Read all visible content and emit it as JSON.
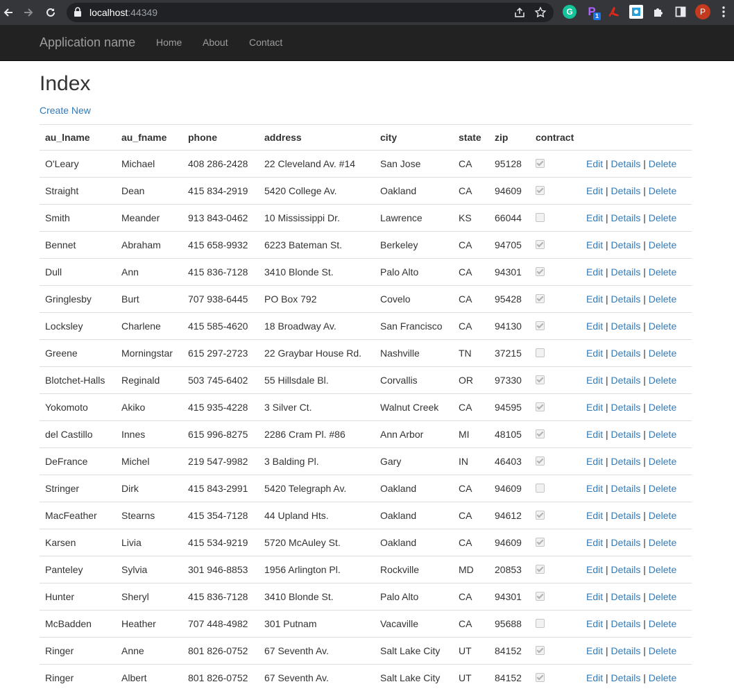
{
  "browser": {
    "url_host": "localhost",
    "url_port": ":44349",
    "profile_initial": "P",
    "ext_grammarly": "G",
    "ext_p": "P",
    "ext_p_badge": "1"
  },
  "navbar": {
    "brand": "Application name",
    "links": [
      "Home",
      "About",
      "Contact"
    ]
  },
  "page": {
    "title": "Index",
    "create_new": "Create New"
  },
  "table": {
    "headers": [
      "au_lname",
      "au_fname",
      "phone",
      "address",
      "city",
      "state",
      "zip",
      "contract"
    ],
    "actions": {
      "edit": "Edit",
      "details": "Details",
      "delete": "Delete",
      "separator": "|"
    },
    "rows": [
      {
        "au_lname": "O'Leary",
        "au_fname": "Michael",
        "phone": "408 286-2428",
        "address": "22 Cleveland Av. #14",
        "city": "San Jose",
        "state": "CA",
        "zip": "95128",
        "contract": true
      },
      {
        "au_lname": "Straight",
        "au_fname": "Dean",
        "phone": "415 834-2919",
        "address": "5420 College Av.",
        "city": "Oakland",
        "state": "CA",
        "zip": "94609",
        "contract": true
      },
      {
        "au_lname": "Smith",
        "au_fname": "Meander",
        "phone": "913 843-0462",
        "address": "10 Mississippi Dr.",
        "city": "Lawrence",
        "state": "KS",
        "zip": "66044",
        "contract": false
      },
      {
        "au_lname": "Bennet",
        "au_fname": "Abraham",
        "phone": "415 658-9932",
        "address": "6223 Bateman St.",
        "city": "Berkeley",
        "state": "CA",
        "zip": "94705",
        "contract": true
      },
      {
        "au_lname": "Dull",
        "au_fname": "Ann",
        "phone": "415 836-7128",
        "address": "3410 Blonde St.",
        "city": "Palo Alto",
        "state": "CA",
        "zip": "94301",
        "contract": true
      },
      {
        "au_lname": "Gringlesby",
        "au_fname": "Burt",
        "phone": "707 938-6445",
        "address": "PO Box 792",
        "city": "Covelo",
        "state": "CA",
        "zip": "95428",
        "contract": true
      },
      {
        "au_lname": "Locksley",
        "au_fname": "Charlene",
        "phone": "415 585-4620",
        "address": "18 Broadway Av.",
        "city": "San Francisco",
        "state": "CA",
        "zip": "94130",
        "contract": true
      },
      {
        "au_lname": "Greene",
        "au_fname": "Morningstar",
        "phone": "615 297-2723",
        "address": "22 Graybar House Rd.",
        "city": "Nashville",
        "state": "TN",
        "zip": "37215",
        "contract": false
      },
      {
        "au_lname": "Blotchet-Halls",
        "au_fname": "Reginald",
        "phone": "503 745-6402",
        "address": "55 Hillsdale Bl.",
        "city": "Corvallis",
        "state": "OR",
        "zip": "97330",
        "contract": true
      },
      {
        "au_lname": "Yokomoto",
        "au_fname": "Akiko",
        "phone": "415 935-4228",
        "address": "3 Silver Ct.",
        "city": "Walnut Creek",
        "state": "CA",
        "zip": "94595",
        "contract": true
      },
      {
        "au_lname": "del Castillo",
        "au_fname": "Innes",
        "phone": "615 996-8275",
        "address": "2286 Cram Pl. #86",
        "city": "Ann Arbor",
        "state": "MI",
        "zip": "48105",
        "contract": true
      },
      {
        "au_lname": "DeFrance",
        "au_fname": "Michel",
        "phone": "219 547-9982",
        "address": "3 Balding Pl.",
        "city": "Gary",
        "state": "IN",
        "zip": "46403",
        "contract": true
      },
      {
        "au_lname": "Stringer",
        "au_fname": "Dirk",
        "phone": "415 843-2991",
        "address": "5420 Telegraph Av.",
        "city": "Oakland",
        "state": "CA",
        "zip": "94609",
        "contract": false
      },
      {
        "au_lname": "MacFeather",
        "au_fname": "Stearns",
        "phone": "415 354-7128",
        "address": "44 Upland Hts.",
        "city": "Oakland",
        "state": "CA",
        "zip": "94612",
        "contract": true
      },
      {
        "au_lname": "Karsen",
        "au_fname": "Livia",
        "phone": "415 534-9219",
        "address": "5720 McAuley St.",
        "city": "Oakland",
        "state": "CA",
        "zip": "94609",
        "contract": true
      },
      {
        "au_lname": "Panteley",
        "au_fname": "Sylvia",
        "phone": "301 946-8853",
        "address": "1956 Arlington Pl.",
        "city": "Rockville",
        "state": "MD",
        "zip": "20853",
        "contract": true
      },
      {
        "au_lname": "Hunter",
        "au_fname": "Sheryl",
        "phone": "415 836-7128",
        "address": "3410 Blonde St.",
        "city": "Palo Alto",
        "state": "CA",
        "zip": "94301",
        "contract": true
      },
      {
        "au_lname": "McBadden",
        "au_fname": "Heather",
        "phone": "707 448-4982",
        "address": "301 Putnam",
        "city": "Vacaville",
        "state": "CA",
        "zip": "95688",
        "contract": false
      },
      {
        "au_lname": "Ringer",
        "au_fname": "Anne",
        "phone": "801 826-0752",
        "address": "67 Seventh Av.",
        "city": "Salt Lake City",
        "state": "UT",
        "zip": "84152",
        "contract": true
      },
      {
        "au_lname": "Ringer",
        "au_fname": "Albert",
        "phone": "801 826-0752",
        "address": "67 Seventh Av.",
        "city": "Salt Lake City",
        "state": "UT",
        "zip": "84152",
        "contract": true
      }
    ]
  }
}
